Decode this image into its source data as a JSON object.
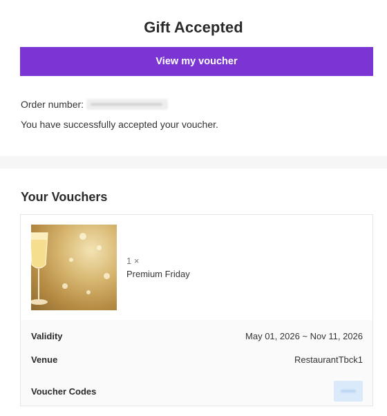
{
  "header": {
    "title": "Gift Accepted",
    "view_button_label": "View my voucher"
  },
  "order": {
    "label": "Order number:",
    "number_redacted": true
  },
  "success_message": "You have successfully accepted your voucher.",
  "vouchers_section": {
    "title": "Your Vouchers",
    "items": [
      {
        "quantity": "1 ×",
        "name": "Premium Friday",
        "image": "champagne-glasses-gold-bokeh",
        "validity_label": "Validity",
        "validity_value": "May 01, 2026 ~ Nov 11, 2026",
        "venue_label": "Venue",
        "venue_value": "RestaurantTbck1",
        "codes_label": "Voucher Codes",
        "code_redacted": true
      }
    ]
  },
  "colors": {
    "primary_button": "#7a35d3",
    "band": "#f6f6f6",
    "details_bg": "#fafafa",
    "code_highlight": "#dbeafb"
  }
}
